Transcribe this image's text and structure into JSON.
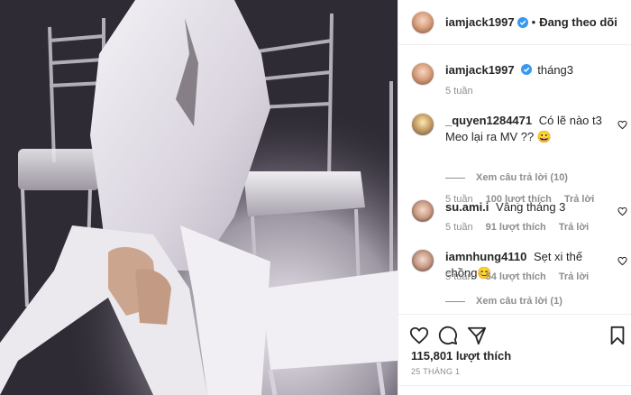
{
  "post": {
    "author": "iamjack1997",
    "follow_status": "Đang theo dõi",
    "separator": "•",
    "caption": "tháng3",
    "caption_age": "5 tuần",
    "likes": "115,801 lượt thích",
    "date": "25 THÁNG 1"
  },
  "comments": [
    {
      "username": "_quyen1284471",
      "text": "Có lẽ nào t3 Meo lại ra MV ?? 😀",
      "age": "5 tuần",
      "likes": "100 lượt thích",
      "reply": "Trả lời",
      "view_replies": "Xem câu trả lời (10)"
    },
    {
      "username": "su.ami.i",
      "text": "Vâng tháng 3",
      "age": "5 tuần",
      "likes": "91 lượt thích",
      "reply": "Trả lời"
    },
    {
      "username": "iamnhung4110",
      "text": "Sẹt xi thế chồng😊",
      "age": "5 tuần",
      "likes": "54 lượt thích",
      "reply": "Trả lời",
      "view_replies": "Xem câu trả lời (1)"
    }
  ],
  "icons": {
    "verified": "verified-badge-icon",
    "like": "heart-icon",
    "comment": "comment-icon",
    "share": "paper-plane-icon",
    "save": "bookmark-icon",
    "comment_like": "heart-icon"
  },
  "colors": {
    "verified": "#3897f0",
    "text": "#262626",
    "muted": "#8e8e8e",
    "border": "#efefef"
  }
}
